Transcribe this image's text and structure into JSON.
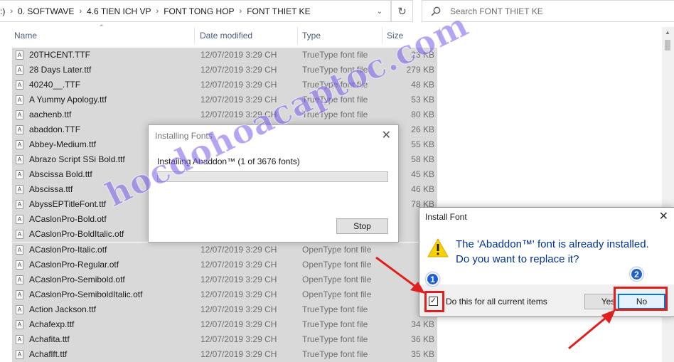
{
  "address": {
    "crumbs": [
      ":)",
      "0. SOFTWAVE",
      "4.6 TIEN ICH VP",
      "FONT TONG HOP",
      "FONT THIET KE"
    ],
    "search_placeholder": "Search FONT THIET KE"
  },
  "columns": {
    "name": "Name",
    "date": "Date modified",
    "type": "Type",
    "size": "Size"
  },
  "files": [
    {
      "name": "20THCENT.TTF",
      "date": "12/07/2019 3:29 CH",
      "type": "TrueType font file",
      "size": "23 KB"
    },
    {
      "name": "28 Days Later.ttf",
      "date": "12/07/2019 3:29 CH",
      "type": "TrueType font file",
      "size": "279 KB"
    },
    {
      "name": "40240__.TTF",
      "date": "12/07/2019 3:29 CH",
      "type": "TrueType font file",
      "size": "48 KB"
    },
    {
      "name": "A Yummy Apology.ttf",
      "date": "12/07/2019 3:29 CH",
      "type": "TrueType font file",
      "size": "53 KB"
    },
    {
      "name": "aachenb.ttf",
      "date": "12/07/2019 3:29 CH",
      "type": "TrueType font file",
      "size": "80 KB"
    },
    {
      "name": "abaddon.TTF",
      "date": "",
      "type": "",
      "size": "26 KB"
    },
    {
      "name": "Abbey-Medium.ttf",
      "date": "",
      "type": "",
      "size": "55 KB"
    },
    {
      "name": "Abrazo Script SSi Bold.ttf",
      "date": "",
      "type": "",
      "size": "58 KB"
    },
    {
      "name": "Abscissa Bold.ttf",
      "date": "",
      "type": "",
      "size": "45 KB"
    },
    {
      "name": "Abscissa.ttf",
      "date": "",
      "type": "",
      "size": "46 KB"
    },
    {
      "name": "AbyssEPTitleFont.ttf",
      "date": "",
      "type": "",
      "size": "78 KB"
    },
    {
      "name": "ACaslonPro-Bold.otf",
      "date": "",
      "type": "",
      "size": "14"
    },
    {
      "name": "ACaslonPro-BoldItalic.otf",
      "date": "",
      "type": "",
      "size": "14"
    },
    {
      "name": "ACaslonPro-Italic.otf",
      "date": "12/07/2019 3:29 CH",
      "type": "OpenType font file",
      "size": "16"
    },
    {
      "name": "ACaslonPro-Regular.otf",
      "date": "12/07/2019 3:29 CH",
      "type": "OpenType font file",
      "size": "16"
    },
    {
      "name": "ACaslonPro-Semibold.otf",
      "date": "12/07/2019 3:29 CH",
      "type": "OpenType font file",
      "size": "16"
    },
    {
      "name": "ACaslonPro-SemiboldItalic.otf",
      "date": "12/07/2019 3:29 CH",
      "type": "OpenType font file",
      "size": "16"
    },
    {
      "name": "Action Jackson.ttf",
      "date": "12/07/2019 3:29 CH",
      "type": "TrueType font file",
      "size": "16"
    },
    {
      "name": "Achafexp.ttf",
      "date": "12/07/2019 3:29 CH",
      "type": "TrueType font file",
      "size": "34 KB"
    },
    {
      "name": "Achafita.ttf",
      "date": "12/07/2019 3:29 CH",
      "type": "TrueType font file",
      "size": "36 KB"
    },
    {
      "name": "Achaflft.ttf",
      "date": "12/07/2019 3:29 CH",
      "type": "TrueType font file",
      "size": "35 KB"
    }
  ],
  "installing": {
    "title": "Installing Fonts",
    "message": "Installing Abaddon™ (1 of 3676 fonts)",
    "progress": 0,
    "stop": "Stop"
  },
  "install_font": {
    "title": "Install Font",
    "line1": "The 'Abaddon™' font is already installed.",
    "line2": "Do you want to replace it?",
    "checkbox_label": "Do this for all current items",
    "checked": true,
    "yes": "Yes",
    "no": "No"
  },
  "annotations": {
    "badge1": "1",
    "badge2": "2",
    "watermark": "hocdohoacaptoc.com"
  },
  "colors": {
    "selection": "#d9d9d9",
    "accent": "#0078d7",
    "highlight": "#e02020",
    "badge": "#1f5fd6"
  }
}
